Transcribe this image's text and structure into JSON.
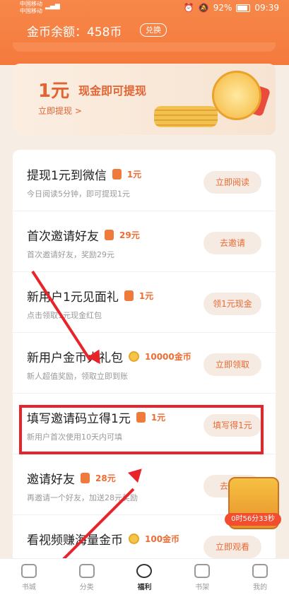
{
  "status": {
    "carrier1": "中国移动",
    "carrier2": "中国移动",
    "battery": "92%",
    "time": "09:39"
  },
  "header": {
    "coin_label": "金币余额：458币",
    "exchange": "兑换"
  },
  "banner": {
    "amount": "1元",
    "title": "现金即可提现",
    "link": "立即提现 >"
  },
  "tasks": [
    {
      "title": "提现1元到微信",
      "reward": "1元",
      "sub": "今日阅读5分钟，即可提现1元",
      "btn": "立即阅读"
    },
    {
      "title": "首次邀请好友",
      "reward": "29元",
      "sub": "首次邀请好友，奖励29元",
      "btn": "去邀请"
    },
    {
      "title": "新用户1元见面礼",
      "reward": "1元",
      "sub": "点击领取1元现金红包",
      "btn": "领1元现金"
    },
    {
      "title": "新用户金币大礼包",
      "reward": "10000金币",
      "sub": "新人超值奖励，领取立即到账",
      "btn": "立即领取"
    },
    {
      "title": "填写邀请码立得1元",
      "reward": "1元",
      "sub": "新用户首次使用10天内可填",
      "btn": "填写得1元"
    },
    {
      "title": "邀请好友",
      "reward": "28元",
      "sub": "再邀请一个好友，加送28元奖励",
      "btn": "去邀请"
    },
    {
      "title": "看视频赚海量金币",
      "reward": "100金币",
      "sub": "",
      "btn": "立即观看"
    }
  ],
  "chest_timer": "0时56分33秒",
  "nav": [
    "书城",
    "分类",
    "福利",
    "书架",
    "我的"
  ],
  "colors": {
    "accent": "#f47a3c",
    "highlight": "#e8242b"
  }
}
